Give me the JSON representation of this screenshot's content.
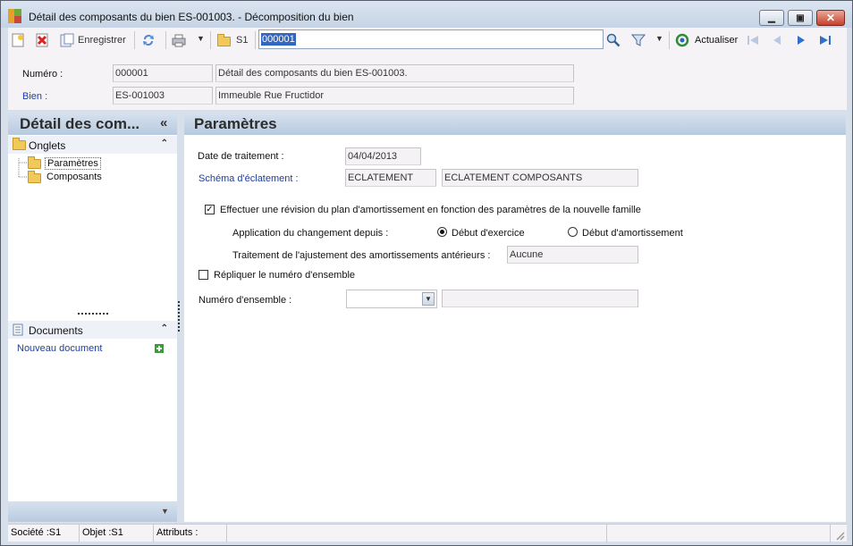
{
  "window": {
    "title": "Détail des composants du bien ES-001003. -  Décomposition du bien"
  },
  "toolbar": {
    "save_label": "Enregistrer",
    "folder_label": "S1",
    "search_value": "000001",
    "refresh_label": "Actualiser"
  },
  "header": {
    "numero_label": "Numéro :",
    "numero_value": "000001",
    "numero_desc": "Détail des composants du bien ES-001003.",
    "bien_label": "Bien :",
    "bien_value": "ES-001003",
    "bien_desc": "Immeuble Rue Fructidor"
  },
  "sidebar": {
    "title": "Détail des com...",
    "collapse": "«",
    "tabs_group": "Onglets",
    "tabs": [
      "Paramètres",
      "Composants"
    ],
    "documents_group": "Documents",
    "new_document": "Nouveau document"
  },
  "main": {
    "title": "Paramètres",
    "date_label": "Date de traitement :",
    "date_value": "04/04/2013",
    "schema_label": "Schéma d'éclatement :",
    "schema_code": "ECLATEMENT",
    "schema_desc": "ECLATEMENT COMPOSANTS",
    "revision_label": "Effectuer une révision du plan d'amortissement en fonction des paramètres de la nouvelle famille",
    "revision_checked": true,
    "application_label": "Application du changement depuis :",
    "radio_exercice": "Début d'exercice",
    "radio_amortissement": "Début d'amortissement",
    "radio_selected": "Début d'exercice",
    "ajustement_label": "Traitement de l'ajustement des amortissements antérieurs :",
    "ajustement_value": "Aucune",
    "repliquer_label": "Répliquer le numéro d'ensemble",
    "repliquer_checked": false,
    "ensemble_label": "Numéro d'ensemble :",
    "ensemble_value": "",
    "ensemble_desc": ""
  },
  "status": {
    "societe": "Société :S1",
    "objet": "Objet :S1",
    "attributs": "Attributs :"
  },
  "colors": {
    "window_bg": "#d7dfea",
    "panel_header": "#b9cadf",
    "link_blue": "#1f3f9f",
    "selection": "#3167c3"
  }
}
